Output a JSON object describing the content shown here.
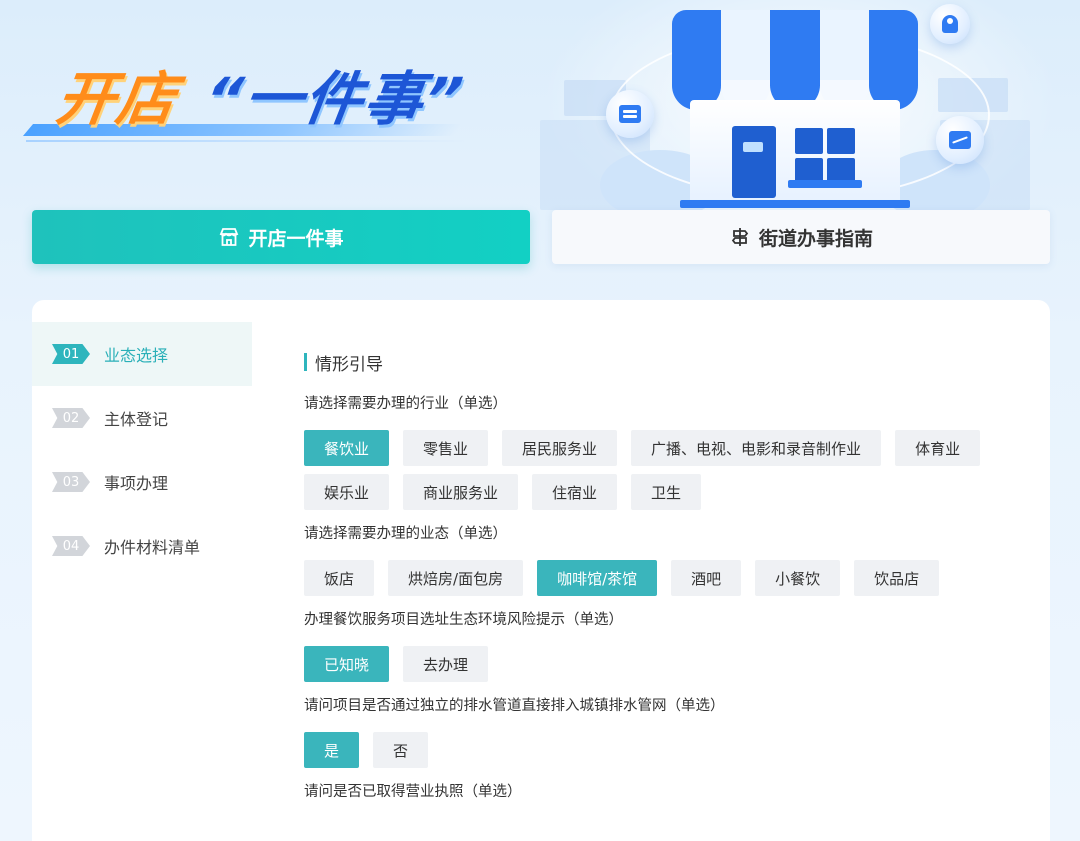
{
  "hero": {
    "title_part1": "开店",
    "title_part2": "“一件事”"
  },
  "tabs": [
    {
      "label": "开店一件事",
      "icon": "store-icon",
      "active": true
    },
    {
      "label": "街道办事指南",
      "icon": "signpost-icon",
      "active": false
    }
  ],
  "steps": [
    {
      "num": "01",
      "label": "业态选择",
      "active": true
    },
    {
      "num": "02",
      "label": "主体登记",
      "active": false
    },
    {
      "num": "03",
      "label": "事项办理",
      "active": false
    },
    {
      "num": "04",
      "label": "办件材料清单",
      "active": false
    }
  ],
  "section": {
    "title": "情形引导"
  },
  "questions": [
    {
      "text": "请选择需要办理的行业（单选）",
      "options": [
        "餐饮业",
        "零售业",
        "居民服务业",
        "广播、电视、电影和录音制作业",
        "体育业",
        "娱乐业",
        "商业服务业",
        "住宿业",
        "卫生"
      ],
      "selected": 0
    },
    {
      "text": "请选择需要办理的业态（单选）",
      "options": [
        "饭店",
        "烘焙房/面包房",
        "咖啡馆/茶馆",
        "酒吧",
        "小餐饮",
        "饮品店"
      ],
      "selected": 2
    },
    {
      "text": "办理餐饮服务项目选址生态环境风险提示（单选）",
      "options": [
        "已知晓",
        "去办理"
      ],
      "selected": 0
    },
    {
      "text": "请问项目是否通过独立的排水管道直接排入城镇排水管网（单选）",
      "options": [
        "是",
        "否"
      ],
      "selected": 0
    },
    {
      "text": "请问是否已取得营业执照（单选）",
      "options": [],
      "selected": -1
    }
  ],
  "colors": {
    "accent": "#3ab5bc",
    "tab_active": "#1fc2bc",
    "brand_blue": "#2f7bf2",
    "brand_orange": "#ff8c1a"
  }
}
